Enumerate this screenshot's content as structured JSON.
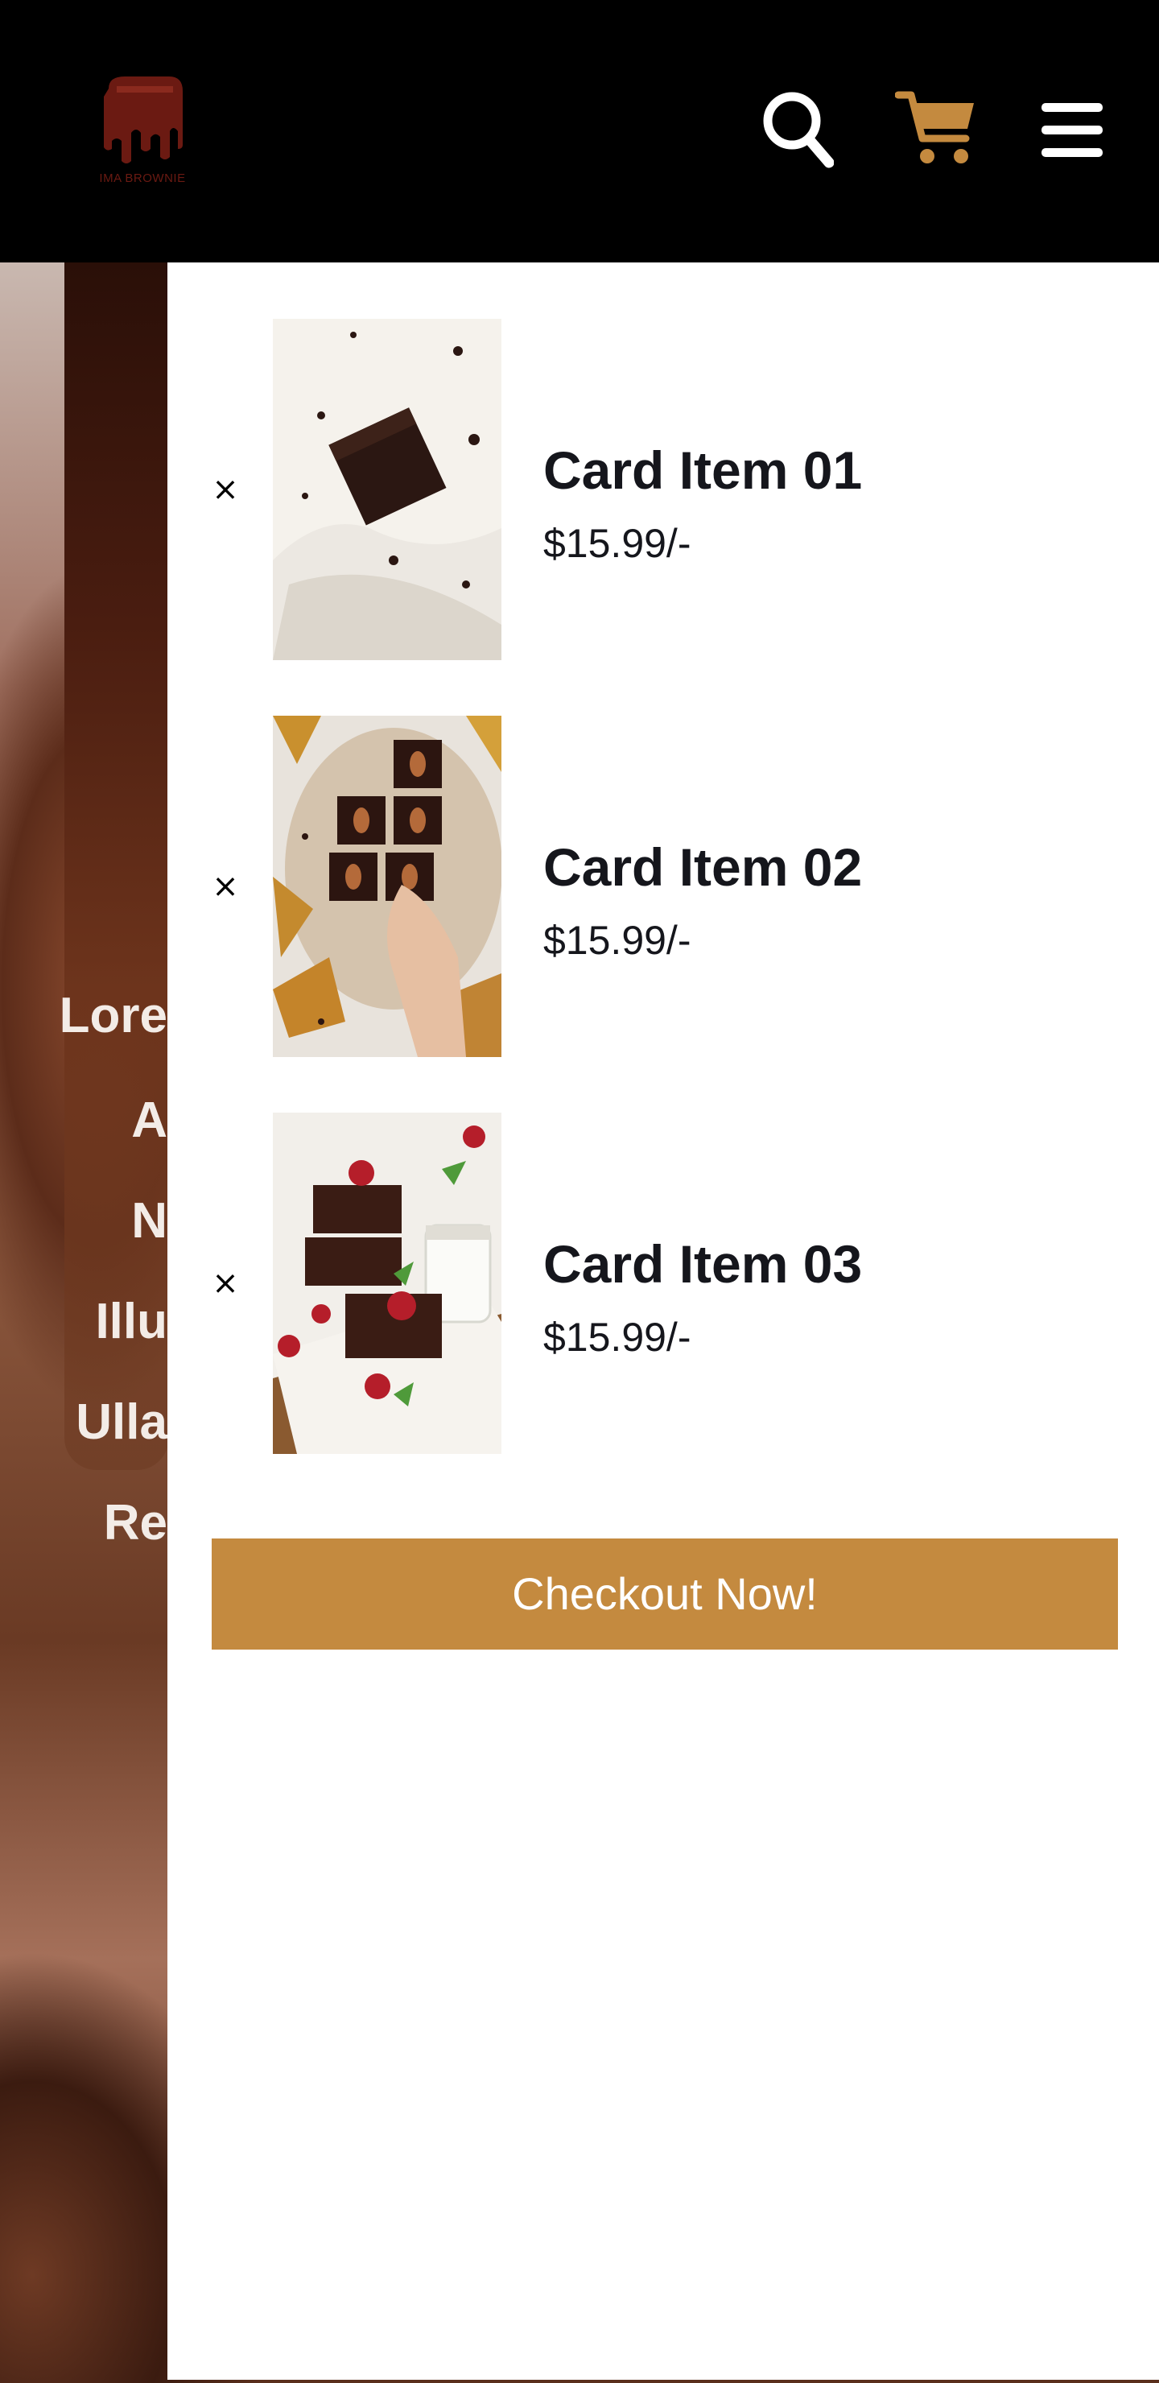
{
  "header": {
    "logo_text": "IMA BROWNIE",
    "search_icon": "search-icon",
    "cart_icon": "cart-icon",
    "menu_icon": "menu-icon"
  },
  "colors": {
    "accent": "#c48a3f",
    "header_bg": "#000000",
    "logo": "#6b1a12",
    "text": "#15161c"
  },
  "hero": {
    "lines": [
      "Lore",
      "A",
      "N",
      "Illu",
      "Ulla",
      "Re"
    ]
  },
  "cart": {
    "remove_symbol": "×",
    "items": [
      {
        "title": "Card Item 01",
        "price": "$15.99/-"
      },
      {
        "title": "Card Item 02",
        "price": "$15.99/-"
      },
      {
        "title": "Card Item 03",
        "price": "$15.99/-"
      }
    ],
    "checkout_label": "Checkout Now!"
  }
}
